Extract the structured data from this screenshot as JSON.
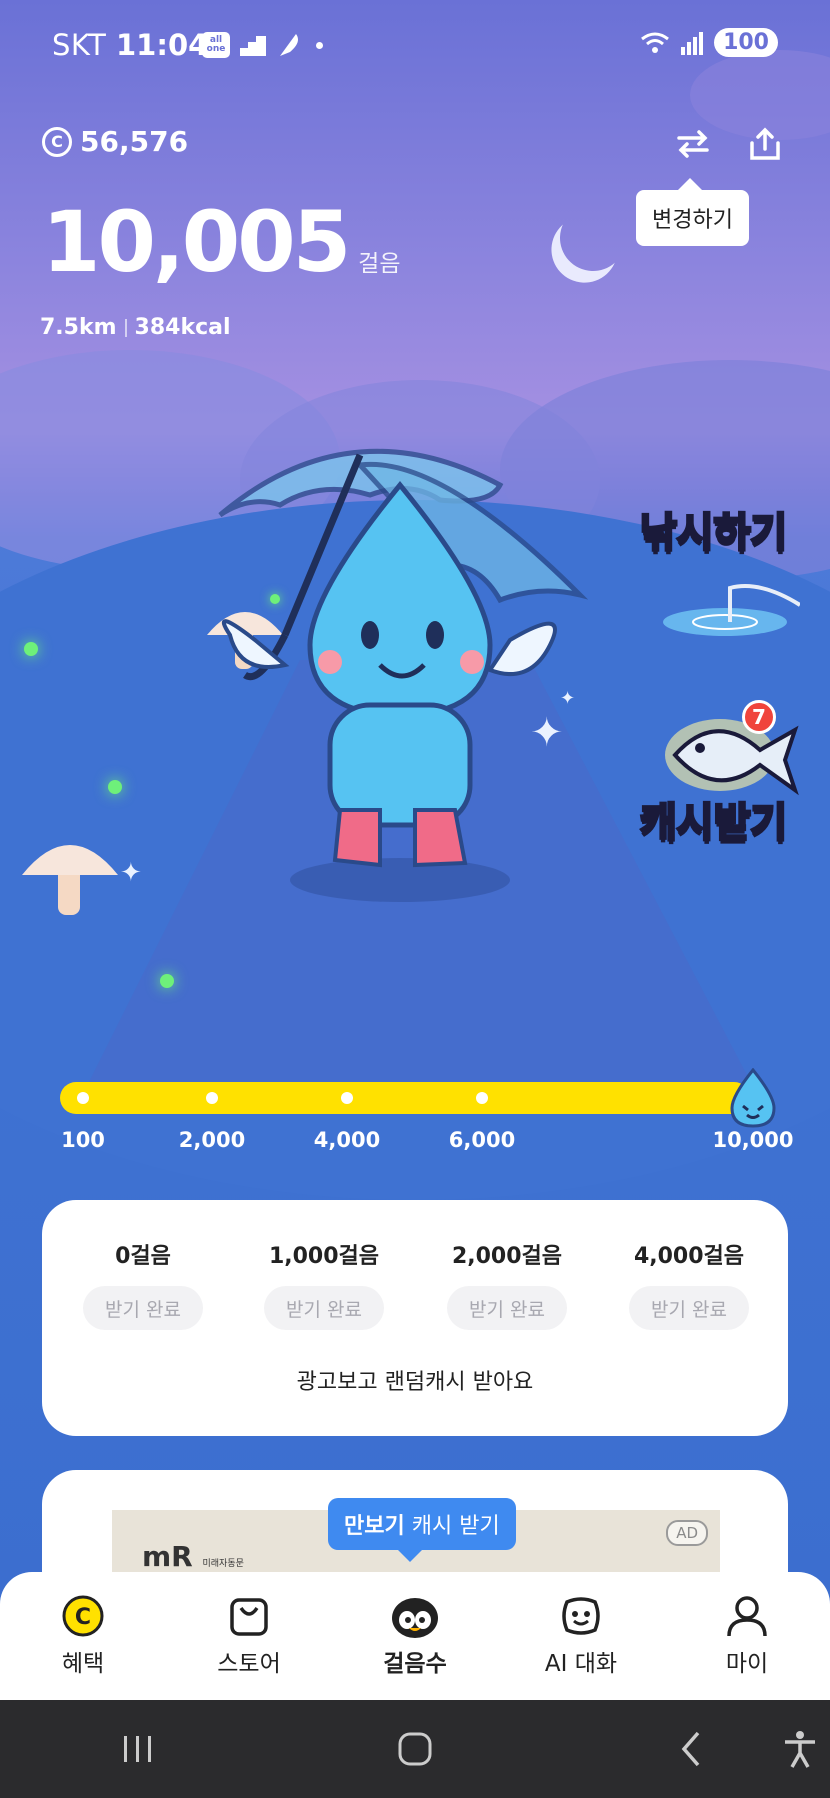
{
  "status_bar": {
    "carrier": "SKT",
    "time": "11:04",
    "battery": "100",
    "app_icon_text": "all one"
  },
  "header": {
    "cash_balance": "56,576",
    "coin_symbol": "C",
    "step_count": "10,005",
    "step_unit": "걸음",
    "distance": "7.5km",
    "calories": "384kcal",
    "change_tooltip": "변경하기"
  },
  "side_actions": {
    "fishing_label": "낚시하기",
    "cash_label": "캐시받기",
    "cash_badge_count": "7"
  },
  "progress": {
    "current_steps": 10005,
    "max_steps": 10000,
    "milestones": [
      "100",
      "2,000",
      "4,000",
      "6,000",
      "10,000"
    ]
  },
  "rewards_card": {
    "milestones": [
      {
        "steps": "0걸음",
        "status": "받기 완료"
      },
      {
        "steps": "1,000걸음",
        "status": "받기 완료"
      },
      {
        "steps": "2,000걸음",
        "status": "받기 완료"
      },
      {
        "steps": "4,000걸음",
        "status": "받기 완료"
      }
    ],
    "ad_prompt": "광고보고 랜덤캐시 받아요"
  },
  "ad_banner": {
    "badge": "AD",
    "logo_text": "mR",
    "logo_subtext": "미래자동문",
    "tooltip_bold": "만보기",
    "tooltip_rest": "캐시 받기"
  },
  "tab_bar": {
    "tabs": [
      {
        "label": "혜택"
      },
      {
        "label": "스토어"
      },
      {
        "label": "걸음수"
      },
      {
        "label": "AI 대화"
      },
      {
        "label": "마이"
      }
    ],
    "active": "걸음수"
  },
  "colors": {
    "progress_fill": "#ffe100",
    "tooltip_blue": "#3f8af0",
    "badge_red": "#f0443c"
  }
}
